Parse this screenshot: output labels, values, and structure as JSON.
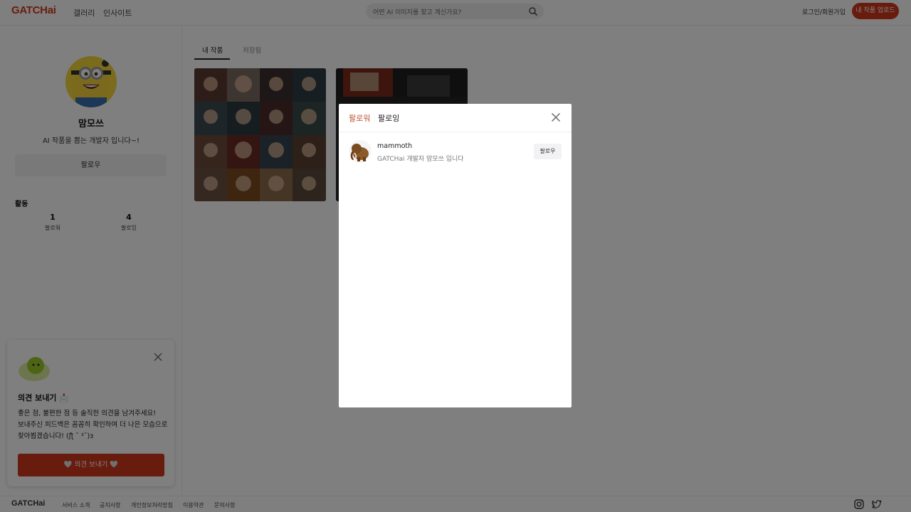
{
  "header": {
    "logo": "GATCHai",
    "nav": [
      "갤러리",
      "인사이트"
    ],
    "search_placeholder": "어떤 AI 이미지를 찾고 계신가요?",
    "login": "로그인/회원가입",
    "upload": "내 작품 업로드"
  },
  "profile": {
    "name": "맘모쓰",
    "bio": "AI 작품을 뽑는 개발자 입니다~!",
    "follow_button": "팔로우",
    "activity_title": "활동",
    "stats": [
      {
        "value": "1",
        "label": "팔로워"
      },
      {
        "value": "4",
        "label": "팔로잉"
      }
    ]
  },
  "feedback": {
    "title": "의견 보내기 📩",
    "line1": "좋은 점, 불편한 점 등 솔직한 의견을 남겨주세요!",
    "line2": "보내주신 피드백은 꼼꼼히 확인하여 더 나은 모습으로",
    "line3": "찾아뵙겠습니다! (ʃƪ ˘ ³˘)ɜ",
    "button": "🤍 의견 보내기 🤍"
  },
  "main": {
    "tabs": [
      "내 작품",
      "저장됨"
    ]
  },
  "footer": {
    "logo": "GATCHai",
    "links": [
      "서비스 소개",
      "공지사항",
      "개인정보처리방침",
      "이용약관",
      "문의사항"
    ]
  },
  "modal": {
    "tabs": [
      "팔로워",
      "팔로잉"
    ],
    "users": [
      {
        "name": "mammoth",
        "description": "GATCHai 개발자 맘모쓰 입니다",
        "button": "팔로우"
      }
    ]
  },
  "colors": {
    "brand": "#d0391c",
    "modal_tab_active": "#c0552f"
  },
  "icons": {
    "search": "search-icon",
    "close": "close-icon",
    "instagram": "instagram-icon",
    "twitter": "twitter-icon"
  }
}
